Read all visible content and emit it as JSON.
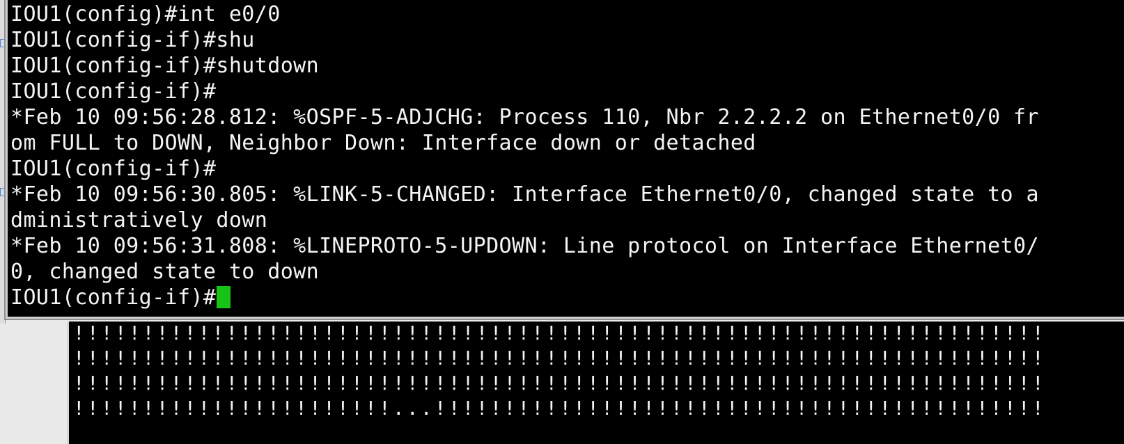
{
  "foreground_terminal": {
    "lines": [
      "IOU1(config)#int e0/0",
      "IOU1(config-if)#shu",
      "IOU1(config-if)#shutdown",
      "IOU1(config-if)#",
      "*Feb 10 09:56:28.812: %OSPF-5-ADJCHG: Process 110, Nbr 2.2.2.2 on Ethernet0/0 fr",
      "om FULL to DOWN, Neighbor Down: Interface down or detached",
      "IOU1(config-if)#",
      "*Feb 10 09:56:30.805: %LINK-5-CHANGED: Interface Ethernet0/0, changed state to a",
      "dministratively down",
      "*Feb 10 09:56:31.808: %LINEPROTO-5-UPDOWN: Line protocol on Interface Ethernet0/",
      "0, changed state to down"
    ],
    "prompt": "IOU1(config-if)#",
    "cursor_color": "#16c316"
  },
  "background_terminal": {
    "lines": [
      "!!!!!!!!!!!!!!!!!!!!!!!!!!!!!!!!!!!!!!!!!!!!!!!!!!!!!!!!!!!!!!!!!!!!!!",
      "!!!!!!!!!!!!!!!!!!!!!!!!!!!!!!!!!!!!!!!!!!!!!!!!!!!!!!!!!!!!!!!!!!!!!!",
      "!!!!!!!!!!!!!!!!!!!!!!!!!!!!!!!!!!!!!!!!!!!!!!!!!!!!!!!!!!!!!!!!!!!!!!",
      "!!!!!!!!!!!!!!!!!!!!!!!...!!!!!!!!!!!!!!!!!!!!!!!!!!!!!!!!!!!!!!!!!!!!"
    ]
  }
}
